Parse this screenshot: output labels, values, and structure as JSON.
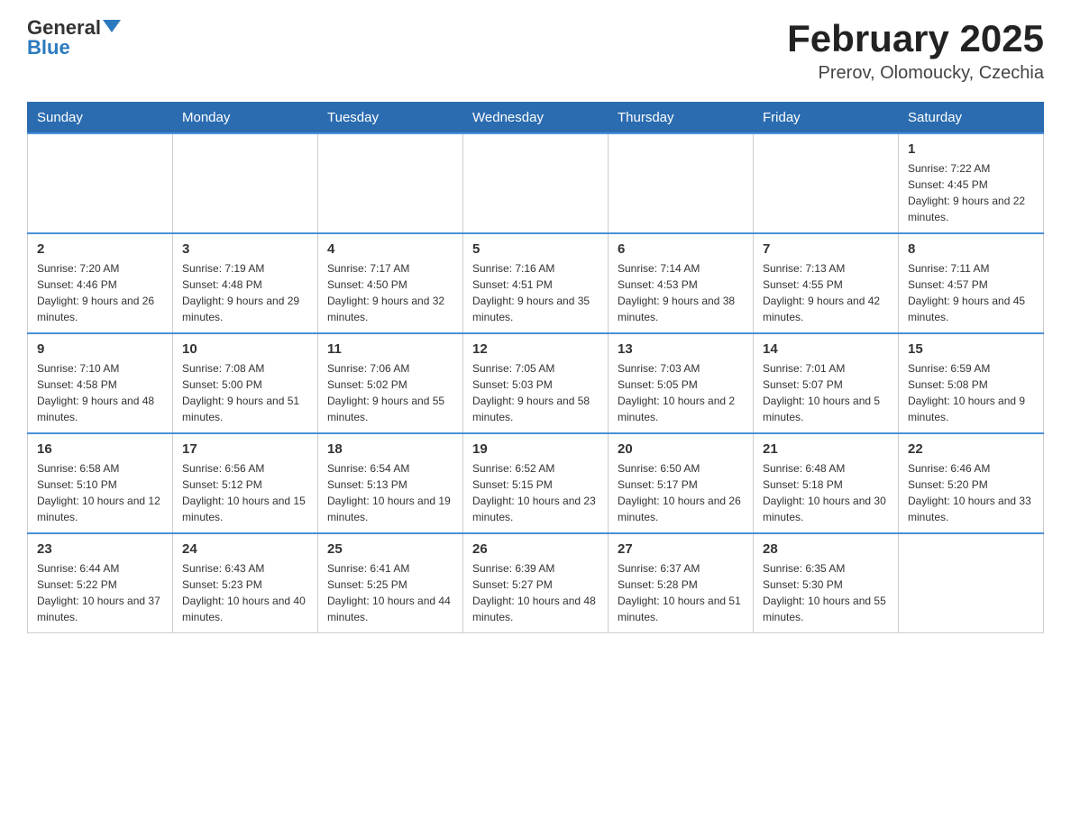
{
  "header": {
    "logo_general": "General",
    "logo_blue": "Blue",
    "title": "February 2025",
    "subtitle": "Prerov, Olomoucky, Czechia"
  },
  "weekdays": [
    "Sunday",
    "Monday",
    "Tuesday",
    "Wednesday",
    "Thursday",
    "Friday",
    "Saturday"
  ],
  "weeks": [
    [
      {
        "day": "",
        "info": ""
      },
      {
        "day": "",
        "info": ""
      },
      {
        "day": "",
        "info": ""
      },
      {
        "day": "",
        "info": ""
      },
      {
        "day": "",
        "info": ""
      },
      {
        "day": "",
        "info": ""
      },
      {
        "day": "1",
        "info": "Sunrise: 7:22 AM\nSunset: 4:45 PM\nDaylight: 9 hours and 22 minutes."
      }
    ],
    [
      {
        "day": "2",
        "info": "Sunrise: 7:20 AM\nSunset: 4:46 PM\nDaylight: 9 hours and 26 minutes."
      },
      {
        "day": "3",
        "info": "Sunrise: 7:19 AM\nSunset: 4:48 PM\nDaylight: 9 hours and 29 minutes."
      },
      {
        "day": "4",
        "info": "Sunrise: 7:17 AM\nSunset: 4:50 PM\nDaylight: 9 hours and 32 minutes."
      },
      {
        "day": "5",
        "info": "Sunrise: 7:16 AM\nSunset: 4:51 PM\nDaylight: 9 hours and 35 minutes."
      },
      {
        "day": "6",
        "info": "Sunrise: 7:14 AM\nSunset: 4:53 PM\nDaylight: 9 hours and 38 minutes."
      },
      {
        "day": "7",
        "info": "Sunrise: 7:13 AM\nSunset: 4:55 PM\nDaylight: 9 hours and 42 minutes."
      },
      {
        "day": "8",
        "info": "Sunrise: 7:11 AM\nSunset: 4:57 PM\nDaylight: 9 hours and 45 minutes."
      }
    ],
    [
      {
        "day": "9",
        "info": "Sunrise: 7:10 AM\nSunset: 4:58 PM\nDaylight: 9 hours and 48 minutes."
      },
      {
        "day": "10",
        "info": "Sunrise: 7:08 AM\nSunset: 5:00 PM\nDaylight: 9 hours and 51 minutes."
      },
      {
        "day": "11",
        "info": "Sunrise: 7:06 AM\nSunset: 5:02 PM\nDaylight: 9 hours and 55 minutes."
      },
      {
        "day": "12",
        "info": "Sunrise: 7:05 AM\nSunset: 5:03 PM\nDaylight: 9 hours and 58 minutes."
      },
      {
        "day": "13",
        "info": "Sunrise: 7:03 AM\nSunset: 5:05 PM\nDaylight: 10 hours and 2 minutes."
      },
      {
        "day": "14",
        "info": "Sunrise: 7:01 AM\nSunset: 5:07 PM\nDaylight: 10 hours and 5 minutes."
      },
      {
        "day": "15",
        "info": "Sunrise: 6:59 AM\nSunset: 5:08 PM\nDaylight: 10 hours and 9 minutes."
      }
    ],
    [
      {
        "day": "16",
        "info": "Sunrise: 6:58 AM\nSunset: 5:10 PM\nDaylight: 10 hours and 12 minutes."
      },
      {
        "day": "17",
        "info": "Sunrise: 6:56 AM\nSunset: 5:12 PM\nDaylight: 10 hours and 15 minutes."
      },
      {
        "day": "18",
        "info": "Sunrise: 6:54 AM\nSunset: 5:13 PM\nDaylight: 10 hours and 19 minutes."
      },
      {
        "day": "19",
        "info": "Sunrise: 6:52 AM\nSunset: 5:15 PM\nDaylight: 10 hours and 23 minutes."
      },
      {
        "day": "20",
        "info": "Sunrise: 6:50 AM\nSunset: 5:17 PM\nDaylight: 10 hours and 26 minutes."
      },
      {
        "day": "21",
        "info": "Sunrise: 6:48 AM\nSunset: 5:18 PM\nDaylight: 10 hours and 30 minutes."
      },
      {
        "day": "22",
        "info": "Sunrise: 6:46 AM\nSunset: 5:20 PM\nDaylight: 10 hours and 33 minutes."
      }
    ],
    [
      {
        "day": "23",
        "info": "Sunrise: 6:44 AM\nSunset: 5:22 PM\nDaylight: 10 hours and 37 minutes."
      },
      {
        "day": "24",
        "info": "Sunrise: 6:43 AM\nSunset: 5:23 PM\nDaylight: 10 hours and 40 minutes."
      },
      {
        "day": "25",
        "info": "Sunrise: 6:41 AM\nSunset: 5:25 PM\nDaylight: 10 hours and 44 minutes."
      },
      {
        "day": "26",
        "info": "Sunrise: 6:39 AM\nSunset: 5:27 PM\nDaylight: 10 hours and 48 minutes."
      },
      {
        "day": "27",
        "info": "Sunrise: 6:37 AM\nSunset: 5:28 PM\nDaylight: 10 hours and 51 minutes."
      },
      {
        "day": "28",
        "info": "Sunrise: 6:35 AM\nSunset: 5:30 PM\nDaylight: 10 hours and 55 minutes."
      },
      {
        "day": "",
        "info": ""
      }
    ]
  ]
}
